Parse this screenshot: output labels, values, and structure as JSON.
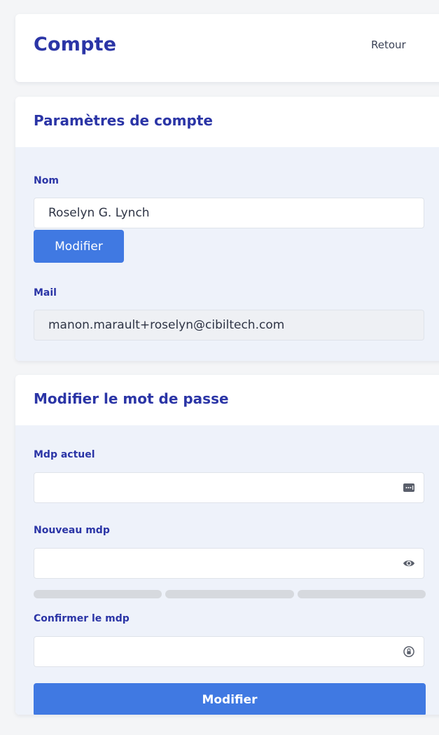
{
  "header": {
    "title": "Compte",
    "back_label": "Retour"
  },
  "account_settings": {
    "title": "Paramètres de compte",
    "name_label": "Nom",
    "name_value": "Roselyn G. Lynch",
    "modify_label": "Modifier",
    "mail_label": "Mail",
    "mail_value": "manon.marault+roselyn@cibiltech.com"
  },
  "change_password": {
    "title": "Modifier le mot de passe",
    "current_label": "Mdp actuel",
    "current_icon": "password-manager-icon",
    "new_label": "Nouveau mdp",
    "new_icon": "eye-icon",
    "strength_segments": 3,
    "confirm_label": "Confirmer le mdp",
    "confirm_icon": "key-lock-icon",
    "submit_label": "Modifier"
  },
  "colors": {
    "accent": "#4079e2",
    "title": "#2b35a6",
    "section_bg": "#eef2fa"
  }
}
